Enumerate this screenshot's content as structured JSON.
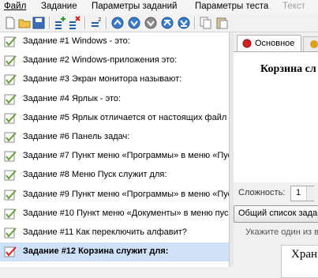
{
  "menu": [
    "Файл",
    "Задание",
    "Параметры заданий",
    "Параметры теста",
    "Текст"
  ],
  "tasks": [
    "Задание #1 Windows - это:",
    "Задание #2 Windows-приложения это:",
    "Задание #3 Экран монитора называют:",
    "Задание #4 Ярлык - это:",
    "Задание #5 Ярлык отличается от настоящих файл",
    "Задание #6 Панель задач:",
    "Задание #7 Пункт меню «Программы» в меню «Пус",
    "Задание #8 Меню Пуск служит для:",
    "Задание #9 Пункт меню «Программы» в меню «Пус",
    "Задание #10 Пункт меню «Документы» в меню пус",
    "Задание #11 Как переключить алфавит?",
    "Задание #12 Корзина служит для:"
  ],
  "selected_index": 11,
  "editor": {
    "tab_main": "Основное",
    "title": "Корзина сл",
    "difficulty_label": "Сложность:",
    "difficulty_value": "1",
    "common_list_button": "Общий список задан",
    "hint": "Укажите один из вар",
    "answer_preview": "Хран"
  },
  "colors": {
    "accent_red": "#d42020",
    "selection": "#cfe1f6",
    "check": "#6a9e3a"
  }
}
